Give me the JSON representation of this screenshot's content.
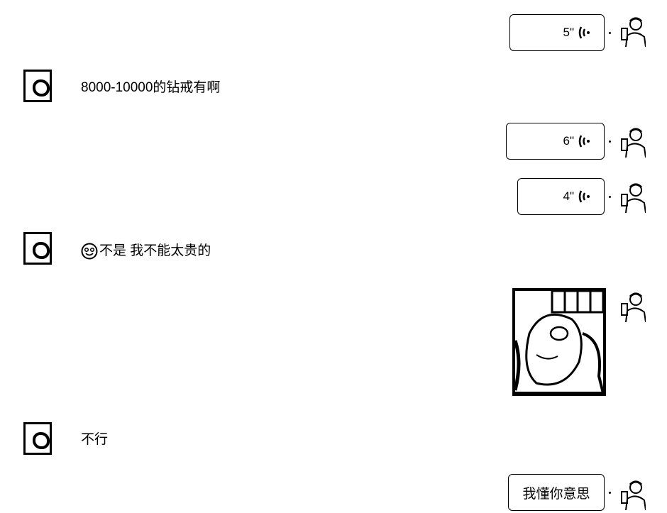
{
  "conversation": {
    "messages": [
      {
        "side": "right",
        "type": "voice",
        "duration": "5\""
      },
      {
        "side": "left",
        "type": "text",
        "text": "8000-10000的钻戒有啊"
      },
      {
        "side": "right",
        "type": "voice",
        "duration": "6\""
      },
      {
        "side": "right",
        "type": "voice",
        "duration": "4\""
      },
      {
        "side": "left",
        "type": "text",
        "emoji": "smile-emoji",
        "text": "不是 我不能太贵的"
      },
      {
        "side": "right",
        "type": "image",
        "description_icon": "photo-thumbnail"
      },
      {
        "side": "left",
        "type": "text",
        "text": "不行"
      },
      {
        "side": "right",
        "type": "text",
        "text": "我懂你意思"
      }
    ]
  },
  "colors": {
    "ink": "#000000",
    "background": "#ffffff"
  }
}
